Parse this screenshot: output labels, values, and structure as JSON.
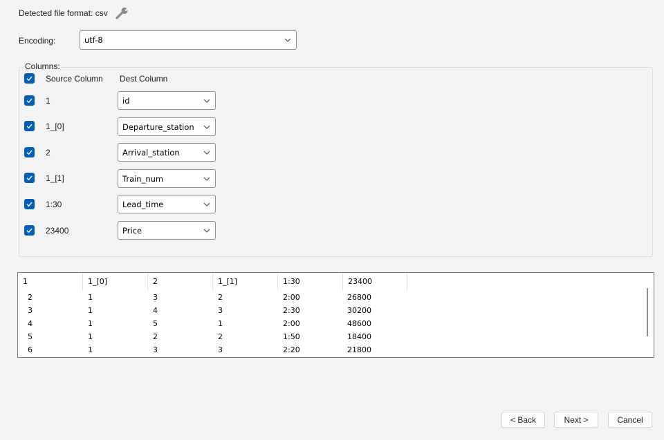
{
  "detected_format": {
    "label": "Detected file format: csv",
    "icon": "wrench-icon"
  },
  "encoding": {
    "label": "Encoding:",
    "value": "utf-8"
  },
  "columns_group": {
    "title": "Columns:",
    "header_source": "Source Column",
    "header_dest": "Dest Column",
    "all_checked": true,
    "rows": [
      {
        "source": "1",
        "dest": "id",
        "checked": true
      },
      {
        "source": "1_[0]",
        "dest": "Departure_station",
        "checked": true
      },
      {
        "source": "2",
        "dest": "Arrival_station",
        "checked": true
      },
      {
        "source": "1_[1]",
        "dest": "Train_num",
        "checked": true
      },
      {
        "source": "1:30",
        "dest": "Lead_time",
        "checked": true
      },
      {
        "source": "23400",
        "dest": "Price",
        "checked": true
      }
    ]
  },
  "preview": {
    "headers": [
      "1",
      "1_[0]",
      "2",
      "1_[1]",
      "1:30",
      "23400"
    ],
    "rows": [
      [
        "2",
        "1",
        "3",
        "2",
        "2:00",
        "26800"
      ],
      [
        "3",
        "1",
        "4",
        "3",
        "2:30",
        "30200"
      ],
      [
        "4",
        "1",
        "5",
        "1",
        "2:00",
        "48600"
      ],
      [
        "5",
        "1",
        "2",
        "2",
        "1:50",
        "18400"
      ],
      [
        "6",
        "1",
        "3",
        "3",
        "2:20",
        "21800"
      ]
    ]
  },
  "buttons": {
    "back": "< Back",
    "next": "Next >",
    "cancel": "Cancel"
  },
  "colors": {
    "checkbox": "#005fb8",
    "background": "#f3f3f3"
  }
}
